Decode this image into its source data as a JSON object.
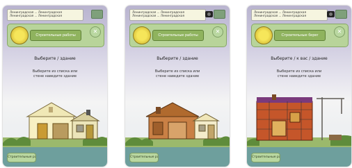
{
  "cards": [
    {
      "address_line_1": "Ленинградская ... Ленинградская",
      "address_line_2": "Ленинградская ... Ленинградская",
      "action_label": "Строительные работы",
      "heading": "Выберите / здание",
      "description_line_1": "Выберите из списка или",
      "description_line_2": "стене наведите здание",
      "bottom_label": "Строительные работы",
      "scene": "house-light-yellow"
    },
    {
      "address_line_1": "Ленинградская ... Ленинградская",
      "address_line_2": "Ленинградская ... Ленинградская",
      "action_label": "Строительные работы",
      "heading": "Выберите / здание",
      "description_line_1": "Выберите из списка или",
      "description_line_2": "стене наведите здание",
      "bottom_label": "Строительные работы",
      "scene": "house-brown"
    },
    {
      "address_line_1": "Ленинградская ... Ленинградская",
      "address_line_2": "Ленинградская ... Ленинградская",
      "action_label": "Строительные берег",
      "heading": "Выберите / к вас / здание",
      "description_line_1": "Выберите из списка или",
      "description_line_2": "стене наведите здание",
      "bottom_label": "Строительные работы",
      "scene": "house-construction"
    }
  ],
  "icons": {
    "menu": "menu-icon",
    "camera": "camera-icon",
    "tools": "tools-icon",
    "clear": "close-icon",
    "logo": "logo-icon"
  },
  "colors": {
    "accent_green": "#8fb35e",
    "panel_green": "#b8d49a",
    "sky_lilac": "#b9b4cf"
  }
}
